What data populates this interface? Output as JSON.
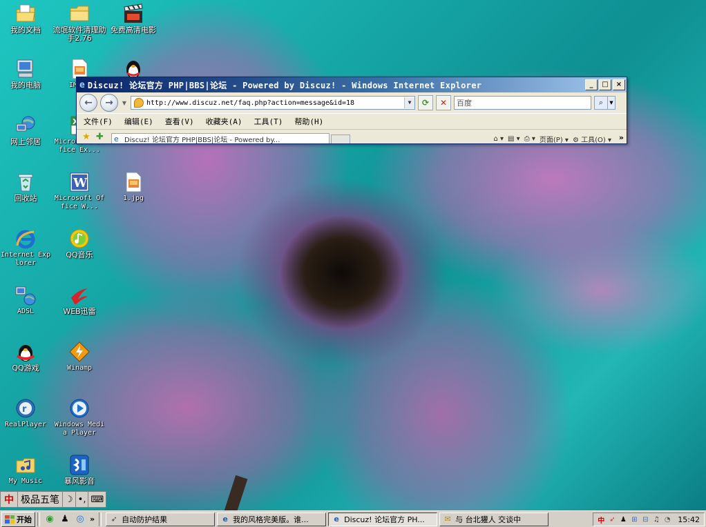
{
  "desktop": {
    "icons": [
      {
        "label": "我的文档",
        "icon": "my-documents-icon"
      },
      {
        "label": "流氓软件清理助手2.76",
        "icon": "folder-icon"
      },
      {
        "label": "免费高清电影",
        "icon": "movie-clapper-icon"
      },
      {
        "label": "我的电脑",
        "icon": "my-computer-icon"
      },
      {
        "label": "IMG01",
        "icon": "image-file-icon"
      },
      {
        "label": "",
        "icon": "qq-penguin-icon"
      },
      {
        "label": "网上邻居",
        "icon": "network-places-icon"
      },
      {
        "label": "Microsoft Office Ex...",
        "icon": "excel-icon"
      },
      {
        "label": "",
        "icon": "partial-image-icon"
      },
      {
        "label": "回收站",
        "icon": "recycle-bin-icon"
      },
      {
        "label": "Microsoft Office W...",
        "icon": "word-icon"
      },
      {
        "label": "1.jpg",
        "icon": "jpg-file-icon"
      },
      {
        "label": "Internet Explorer",
        "icon": "internet-explorer-icon"
      },
      {
        "label": "QQ音乐",
        "icon": "qq-music-icon"
      },
      {
        "label": "ADSL",
        "icon": "adsl-connection-icon"
      },
      {
        "label": "WEB迅雷",
        "icon": "web-thunder-icon"
      },
      {
        "label": "QQ游戏",
        "icon": "qq-game-icon"
      },
      {
        "label": "Winamp",
        "icon": "winamp-icon"
      },
      {
        "label": "RealPlayer",
        "icon": "realplayer-icon"
      },
      {
        "label": "Windows Media Player",
        "icon": "windows-media-player-icon"
      },
      {
        "label": "My Music",
        "icon": "my-music-icon"
      },
      {
        "label": "暴风影音",
        "icon": "baofeng-player-icon"
      }
    ]
  },
  "ie_window": {
    "title": "Discuz! 论坛官方 PHP|BBS|论坛 - Powered by Discuz! - Windows Internet Explorer",
    "address_url": "http://www.discuz.net/faq.php?action=message&id=18",
    "search_placeholder": "百度",
    "menu": [
      "文件(F)",
      "编辑(E)",
      "查看(V)",
      "收藏夹(A)",
      "工具(T)",
      "帮助(H)"
    ],
    "tab_label": "Discuz! 论坛官方 PHP|BBS|论坛 - Powered by...",
    "command_page": "页面(P)",
    "command_tools": "工具(O)",
    "window_buttons": {
      "minimize": "_",
      "maximize": "□",
      "close": "×"
    }
  },
  "ime_bar": {
    "logo": "中",
    "name": "极品五笔",
    "moon": "☽",
    "punct": "•,",
    "keyboard": "⌨"
  },
  "taskbar": {
    "start_label": "开始",
    "quick_more": "»",
    "tasks": [
      {
        "label": "自动防护结果",
        "icon": "shield-task-icon",
        "active": false
      },
      {
        "label": "我的风格完美版。谁...",
        "icon": "ie-task-icon",
        "active": false
      },
      {
        "label": "Discuz! 论坛官方 PH...",
        "icon": "ie-task-icon",
        "active": true
      },
      {
        "label": "与 台北獾人 交谈中",
        "icon": "chat-task-icon",
        "active": false
      }
    ],
    "clock": "15:42"
  },
  "colors": {
    "titlebar_start": "#0a246a",
    "titlebar_end": "#a6caf0",
    "taskbar_bg": "#d4d0c8"
  }
}
